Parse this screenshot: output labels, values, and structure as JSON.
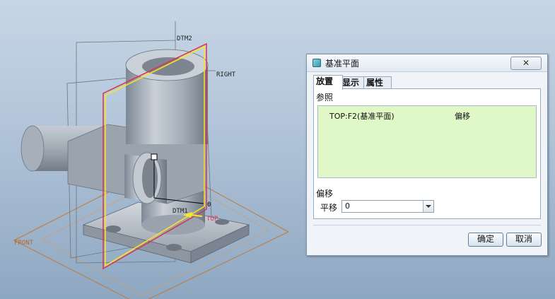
{
  "viewport": {
    "datum_labels": {
      "dtm2": "DTM2",
      "right": "RIGHT",
      "front": "FRONT",
      "dtm1": "DTM1",
      "top": "TOP",
      "offset_handle_value": "0"
    },
    "colors": {
      "background_top": "#c7d6e6",
      "background_bottom": "#8ea7c1",
      "part_gray": "#a9b2bc",
      "datum_yellow": "#f5e62a",
      "datum_red": "#d8324e",
      "datum_orange": "#c07a35"
    }
  },
  "dialog": {
    "title": "基准平面",
    "close_label": "✕",
    "tabs": [
      {
        "label": "放置",
        "active": true
      },
      {
        "label": "显示",
        "active": false
      },
      {
        "label": "属性",
        "active": false
      }
    ],
    "references": {
      "label": "参照",
      "items": [
        {
          "name": "TOP:F2(基准平面)",
          "constraint": "偏移"
        }
      ],
      "highlight_color": "#e0f8c8"
    },
    "offset": {
      "label": "偏移",
      "translate_label": "平移",
      "value": "0"
    },
    "buttons": {
      "ok": "确定",
      "cancel": "取消"
    }
  }
}
